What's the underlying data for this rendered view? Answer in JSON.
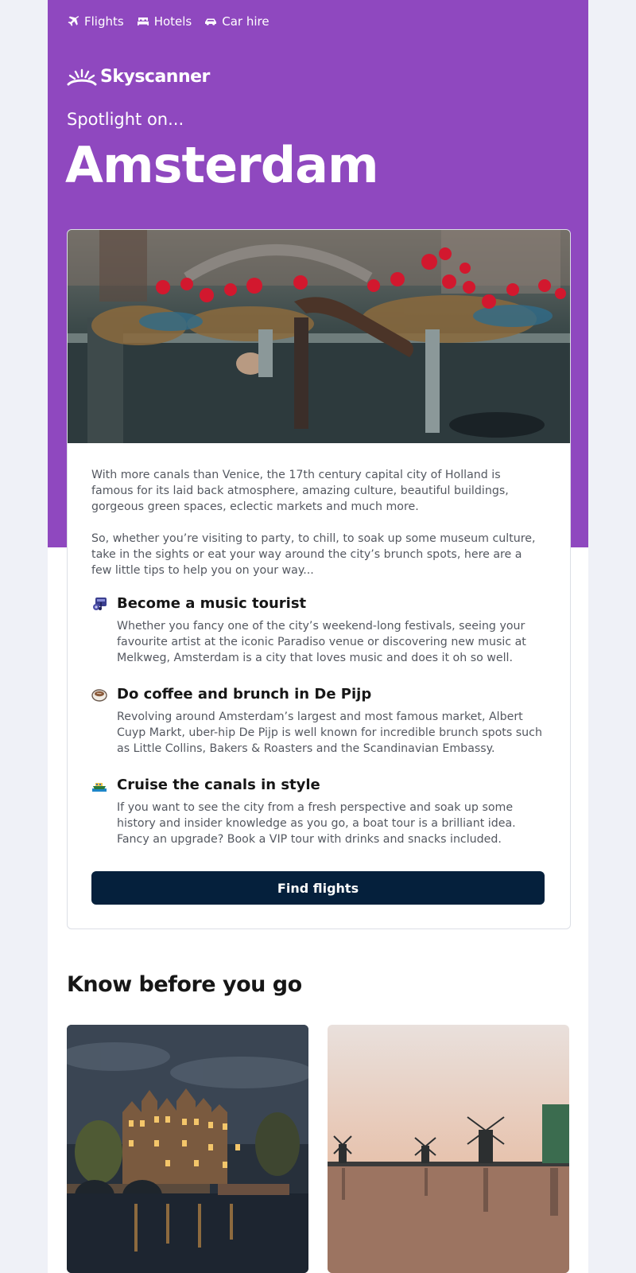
{
  "nav": [
    {
      "label": "Flights",
      "icon": "plane-icon"
    },
    {
      "label": "Hotels",
      "icon": "bed-icon"
    },
    {
      "label": "Car hire",
      "icon": "car-icon"
    }
  ],
  "brand": {
    "name": "Skyscanner",
    "color": "#8f48bf",
    "dark": "#05203c"
  },
  "hero": {
    "kicker": "Spotlight on...",
    "city": "Amsterdam",
    "image_icon": "canal-flowers-bicycle-photo"
  },
  "intro": [
    "With more canals than Venice, the 17th century capital city of Holland is famous for its laid back atmosphere, amazing culture, beautiful buildings, gorgeous green spaces, eclectic markets and much more.",
    "So, whether you’re visiting to party, to chill, to soak up some museum culture, take in the sights or eat your way around the city’s brunch spots, here are a few little tips to help you on your way..."
  ],
  "tips": [
    {
      "icon": "music-icon",
      "title": "Become a music tourist",
      "text": "Whether you fancy one of the city’s weekend-long festivals, seeing your favourite artist at the iconic Paradiso venue or discovering new music at Melkweg, Amsterdam is a city that loves music and does it oh so well."
    },
    {
      "icon": "coffee-icon",
      "title": "Do coffee and brunch in De Pijp",
      "text": "Revolving around Amsterdam’s largest and most famous market, Albert Cuyp Markt, uber-hip De Pijp is well known for incredible brunch spots such as Little Collins, Bakers & Roasters and the Scandinavian Embassy."
    },
    {
      "icon": "boat-icon",
      "title": "Cruise the canals in style",
      "text": "If you want to see the city from a fresh perspective and soak up some history and insider knowledge as you go, a boat tour is a brilliant idea. Fancy an upgrade? Book a VIP tour with drinks and snacks included."
    }
  ],
  "cta": {
    "label": "Find flights"
  },
  "section": {
    "title": "Know before you go"
  }
}
